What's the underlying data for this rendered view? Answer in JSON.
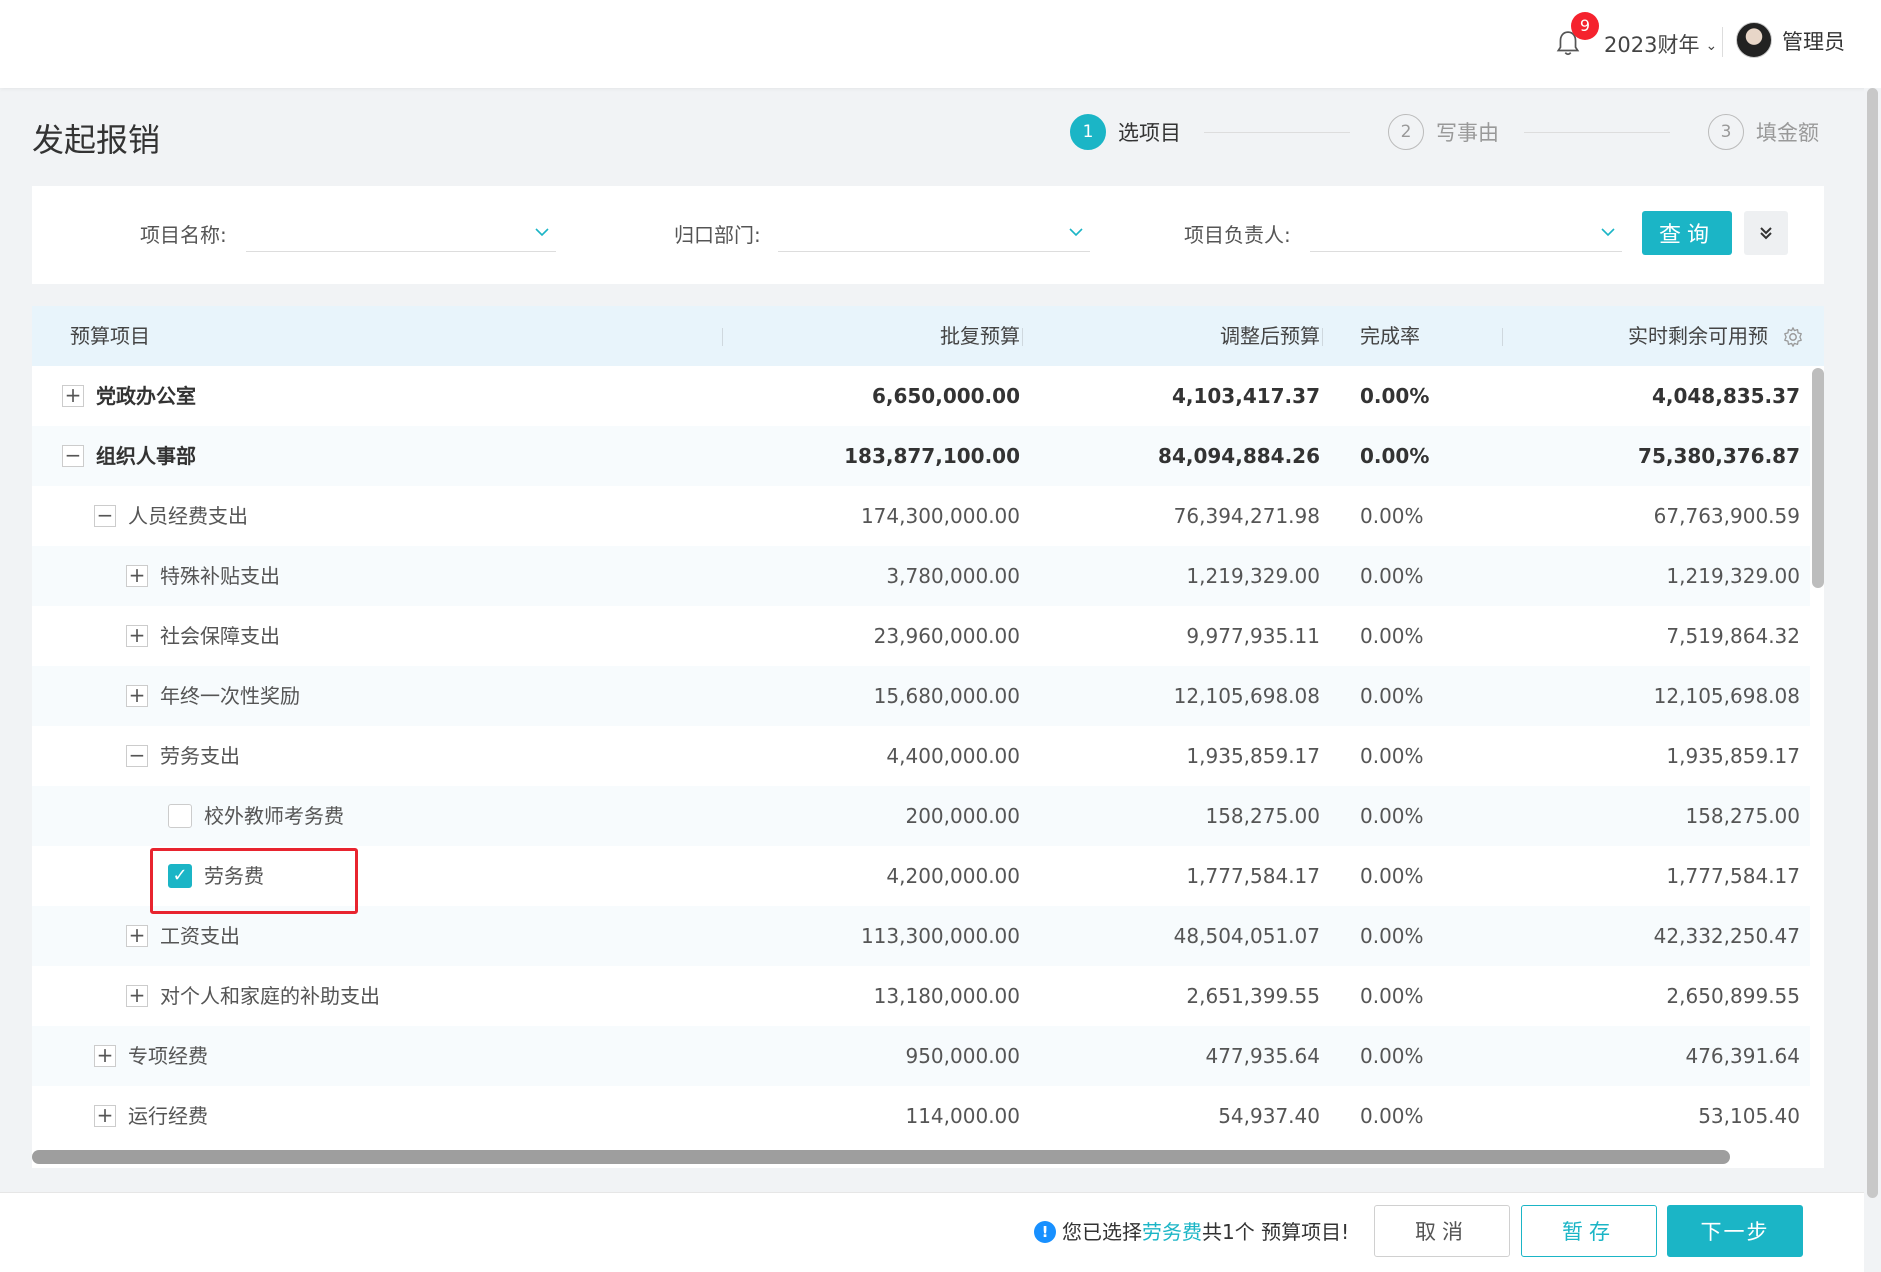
{
  "header": {
    "notification_count": "9",
    "fiscal_year": "2023财年",
    "username": "管理员"
  },
  "page": {
    "title": "发起报销"
  },
  "steps": [
    {
      "num": "1",
      "label": "选项目",
      "active": true
    },
    {
      "num": "2",
      "label": "写事由",
      "active": false
    },
    {
      "num": "3",
      "label": "填金额",
      "active": false
    }
  ],
  "filters": {
    "project_name_label": "项目名称:",
    "department_label": "归口部门:",
    "owner_label": "项目负责人:",
    "query_label": "查询"
  },
  "table": {
    "columns": [
      "预算项目",
      "批复预算",
      "调整后预算",
      "完成率",
      "实时剩余可用预"
    ],
    "rows": [
      {
        "toggle": "+",
        "name": "党政办公室",
        "approved": "6,650,000.00",
        "adjusted": "4,103,417.37",
        "rate": "0.00%",
        "remaining": "4,048,835.37",
        "bold": true
      },
      {
        "toggle": "−",
        "name": "组织人事部",
        "approved": "183,877,100.00",
        "adjusted": "84,094,884.26",
        "rate": "0.00%",
        "remaining": "75,380,376.87",
        "bold": true
      },
      {
        "toggle": "−",
        "name": "人员经费支出",
        "approved": "174,300,000.00",
        "adjusted": "76,394,271.98",
        "rate": "0.00%",
        "remaining": "67,763,900.59"
      },
      {
        "toggle": "+",
        "name": "特殊补贴支出",
        "approved": "3,780,000.00",
        "adjusted": "1,219,329.00",
        "rate": "0.00%",
        "remaining": "1,219,329.00"
      },
      {
        "toggle": "+",
        "name": "社会保障支出",
        "approved": "23,960,000.00",
        "adjusted": "9,977,935.11",
        "rate": "0.00%",
        "remaining": "7,519,864.32"
      },
      {
        "toggle": "+",
        "name": "年终一次性奖励",
        "approved": "15,680,000.00",
        "adjusted": "12,105,698.08",
        "rate": "0.00%",
        "remaining": "12,105,698.08"
      },
      {
        "toggle": "−",
        "name": "劳务支出",
        "approved": "4,400,000.00",
        "adjusted": "1,935,859.17",
        "rate": "0.00%",
        "remaining": "1,935,859.17"
      },
      {
        "checkbox": false,
        "name": "校外教师考务费",
        "approved": "200,000.00",
        "adjusted": "158,275.00",
        "rate": "0.00%",
        "remaining": "158,275.00"
      },
      {
        "checkbox": true,
        "name": "劳务费",
        "approved": "4,200,000.00",
        "adjusted": "1,777,584.17",
        "rate": "0.00%",
        "remaining": "1,777,584.17"
      },
      {
        "toggle": "+",
        "name": "工资支出",
        "approved": "113,300,000.00",
        "adjusted": "48,504,051.07",
        "rate": "0.00%",
        "remaining": "42,332,250.47"
      },
      {
        "toggle": "+",
        "name": "对个人和家庭的补助支出",
        "approved": "13,180,000.00",
        "adjusted": "2,651,399.55",
        "rate": "0.00%",
        "remaining": "2,650,899.55"
      },
      {
        "toggle": "+",
        "name": "专项经费",
        "approved": "950,000.00",
        "adjusted": "477,935.64",
        "rate": "0.00%",
        "remaining": "476,391.64"
      },
      {
        "toggle": "+",
        "name": "运行经费",
        "approved": "114,000.00",
        "adjusted": "54,937.40",
        "rate": "0.00%",
        "remaining": "53,105.40"
      }
    ]
  },
  "footer": {
    "msg_prefix": "您已选择",
    "msg_item": "劳务费",
    "msg_suffix": "共1个 预算项目!",
    "cancel_label": "取消",
    "save_label": "暂存",
    "next_label": "下一步"
  },
  "colors": {
    "accent": "#1bb5c6",
    "badge": "#f5222d",
    "highlight_border": "#e8242f"
  }
}
